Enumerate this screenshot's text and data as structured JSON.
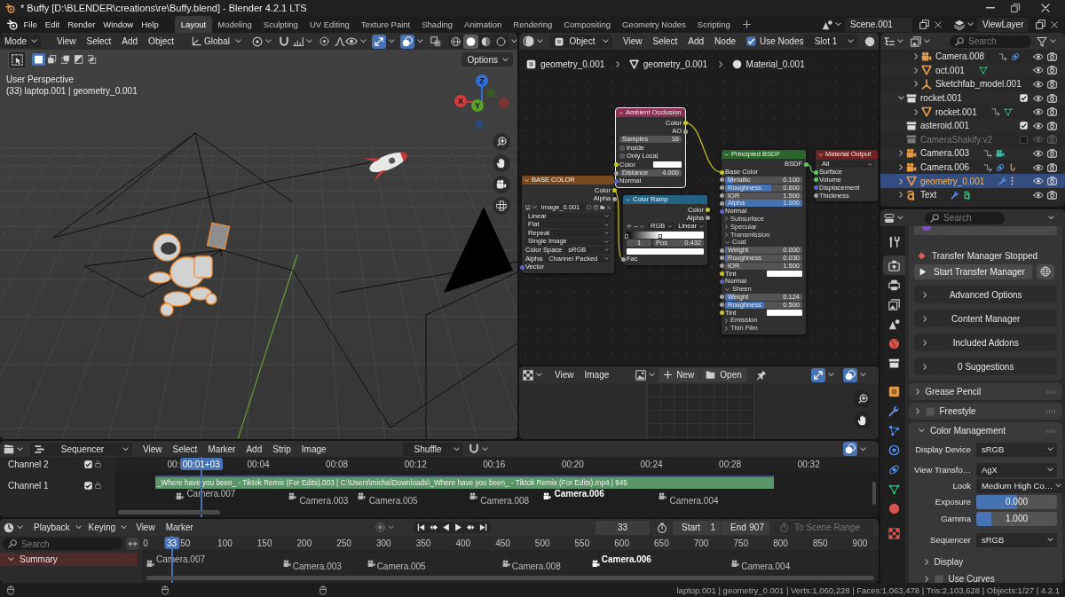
{
  "window": {
    "title": "* Buffy [D:\\BLENDER\\creations\\re\\Buffy.blend] - Blender 4.2.1 LTS"
  },
  "top_bar": {
    "menus": [
      "File",
      "Edit",
      "Render",
      "Window",
      "Help"
    ],
    "workspaces": [
      {
        "label": "Layout",
        "selected": true
      },
      {
        "label": "Modeling",
        "selected": false
      },
      {
        "label": "Sculpting",
        "selected": false
      },
      {
        "label": "UV Editing",
        "selected": false
      },
      {
        "label": "Texture Paint",
        "selected": false
      },
      {
        "label": "Shading",
        "selected": false
      },
      {
        "label": "Animation",
        "selected": false
      },
      {
        "label": "Rendering",
        "selected": false
      },
      {
        "label": "Compositing",
        "selected": false
      },
      {
        "label": "Geometry Nodes",
        "selected": false
      },
      {
        "label": "Scripting",
        "selected": false
      }
    ],
    "scene": "Scene.001",
    "view_layer": "ViewLayer"
  },
  "viewport": {
    "mode": "Mode",
    "menus": [
      "View",
      "Select",
      "Add",
      "Object"
    ],
    "orientation": "Global",
    "toggles": [
      {
        "kind": "gizmos",
        "on": true
      },
      {
        "kind": "overlays",
        "on": true
      },
      {
        "kind": "xray",
        "on": false
      }
    ],
    "shading": [
      {
        "kind": "wireframe",
        "selected": false
      },
      {
        "kind": "solid",
        "selected": true
      },
      {
        "kind": "material",
        "selected": false
      },
      {
        "kind": "rendered",
        "selected": false
      }
    ],
    "select_modes": [
      {
        "kind": "set",
        "selected": true
      },
      {
        "kind": "extend",
        "selected": false
      },
      {
        "kind": "subtract",
        "selected": false
      },
      {
        "kind": "invert",
        "selected": false
      },
      {
        "kind": "intersect",
        "selected": false
      }
    ],
    "options": "Options",
    "info": [
      "User Perspective",
      "(33) laptop.001 | geometry_0.001"
    ],
    "gizmo_axes": [
      "Z",
      "Y",
      "X"
    ]
  },
  "node_editor": {
    "object_type": "Object",
    "menus": [
      "View",
      "Select",
      "Add",
      "Node"
    ],
    "use_nodes": {
      "label": "Use Nodes",
      "checked": true
    },
    "slot": "Slot 1",
    "breadcrumbs": [
      {
        "label": "geometry_0.001",
        "kind": "object"
      },
      {
        "label": "geometry_0.001",
        "kind": "mesh"
      },
      {
        "label": "Material_0.001",
        "kind": "material"
      }
    ],
    "nodes": [
      {
        "title": "BASE COLOR",
        "kind": "texture",
        "selected": false,
        "rows": [
          {
            "kind": "output",
            "label": "Color",
            "color": "#c7c729"
          },
          {
            "kind": "output",
            "label": "Alpha",
            "color": "#a1a1a1"
          },
          {
            "kind": "image",
            "value": "Image_0.001"
          },
          {
            "kind": "dropdown",
            "value": "Linear"
          },
          {
            "kind": "dropdown",
            "value": "Flat"
          },
          {
            "kind": "dropdown",
            "value": "Repeat"
          },
          {
            "kind": "dropdown",
            "value": "Single Image"
          },
          {
            "kind": "dropdown",
            "label": "Color Space",
            "value": "sRGB"
          },
          {
            "kind": "dropdown",
            "label": "Alpha",
            "value": "Channel Packed"
          },
          {
            "kind": "input",
            "label": "Vector",
            "color": "#6363c7"
          }
        ]
      },
      {
        "title": "Ambient Occlusion",
        "kind": "input",
        "selected": true,
        "rows": [
          {
            "kind": "output",
            "label": "Color",
            "color": "#c7c729"
          },
          {
            "kind": "output",
            "label": "AO",
            "color": "#a1a1a1"
          },
          {
            "kind": "number",
            "label": "Samples",
            "value": "16"
          },
          {
            "kind": "checkbox",
            "label": "Inside",
            "checked": false
          },
          {
            "kind": "checkbox",
            "label": "Only Local",
            "checked": false
          },
          {
            "kind": "color",
            "label": "Color",
            "color": "#c7c729"
          },
          {
            "kind": "number",
            "label": "Distance",
            "value": "4.000",
            "color": "#a1a1a1"
          },
          {
            "kind": "input",
            "label": "Normal",
            "color": "#6363c7"
          }
        ]
      },
      {
        "title": "Color Ramp",
        "kind": "converter",
        "selected": false,
        "rows": [
          {
            "kind": "output",
            "label": "Color",
            "color": "#c7c729"
          },
          {
            "kind": "output",
            "label": "Alpha",
            "color": "#a1a1a1"
          },
          {
            "kind": "ramp_controls",
            "mode": "RGB",
            "interpolation": "Linear"
          },
          {
            "kind": "ramp",
            "stops": [
              {
                "level": 0,
                "selected": false
              },
              {
                "level": 0.432,
                "selected": true
              }
            ]
          },
          {
            "kind": "stop",
            "index": "1",
            "label": "Pos",
            "value": "0.432"
          },
          {
            "kind": "swatch"
          },
          {
            "kind": "input",
            "label": "Fac",
            "color": "#a1a1a1"
          }
        ]
      },
      {
        "title": "Principled BSDF",
        "kind": "shader",
        "selected": false,
        "rows": [
          {
            "kind": "output",
            "label": "BSDF",
            "color": "#63c763"
          },
          {
            "kind": "input",
            "label": "Base Color",
            "color": "#c7c729"
          },
          {
            "kind": "slider",
            "label": "Metallic",
            "value": "0.100",
            "level": 0.1,
            "color": "#a1a1a1"
          },
          {
            "kind": "slider",
            "label": "Roughness",
            "value": "0.600",
            "level": 0.6,
            "color": "#a1a1a1"
          },
          {
            "kind": "number",
            "label": "IOR",
            "value": "1.500",
            "color": "#a1a1a1"
          },
          {
            "kind": "slider",
            "label": "Alpha",
            "value": "1.000",
            "level": 1,
            "color": "#a1a1a1"
          },
          {
            "kind": "input",
            "label": "Normal",
            "color": "#6363c7"
          },
          {
            "kind": "panel",
            "label": "Subsurface",
            "expanded": false
          },
          {
            "kind": "panel",
            "label": "Specular",
            "expanded": false
          },
          {
            "kind": "panel",
            "label": "Transmission",
            "expanded": false
          },
          {
            "kind": "panel",
            "label": "Coat",
            "expanded": true
          },
          {
            "kind": "slider",
            "label": "Weight",
            "value": "0.000",
            "level": 0,
            "color": "#a1a1a1"
          },
          {
            "kind": "slider",
            "label": "Roughness",
            "value": "0.030",
            "level": 0.03,
            "color": "#a1a1a1"
          },
          {
            "kind": "number",
            "label": "IOR",
            "value": "1.500",
            "color": "#a1a1a1"
          },
          {
            "kind": "color",
            "label": "Tint",
            "color": "#c7c729"
          },
          {
            "kind": "input",
            "label": "Normal",
            "color": "#6363c7"
          },
          {
            "kind": "panel",
            "label": "Sheen",
            "expanded": true
          },
          {
            "kind": "slider",
            "label": "Weight",
            "value": "0.124",
            "level": 0.124,
            "color": "#a1a1a1"
          },
          {
            "kind": "slider",
            "label": "Roughness",
            "value": "0.500",
            "level": 0.5,
            "color": "#a1a1a1"
          },
          {
            "kind": "color",
            "label": "Tint",
            "color": "#c7c729"
          },
          {
            "kind": "panel",
            "label": "Emission",
            "expanded": false
          },
          {
            "kind": "panel",
            "label": "Thin Film",
            "expanded": false
          }
        ]
      },
      {
        "title": "Material Output",
        "kind": "output",
        "selected": false,
        "rows": [
          {
            "kind": "dropdown",
            "value": "All"
          },
          {
            "kind": "input",
            "label": "Surface",
            "color": "#63c763"
          },
          {
            "kind": "input",
            "label": "Volume",
            "color": "#63c763"
          },
          {
            "kind": "input",
            "label": "Displacement",
            "color": "#6363c7"
          },
          {
            "kind": "input",
            "label": "Thickness",
            "color": "#a1a1a1"
          }
        ]
      }
    ]
  },
  "image_editor": {
    "menus": [
      "View",
      "Image"
    ],
    "new_button": "New",
    "open_button": "Open",
    "toggles": [
      {
        "kind": "gizmos",
        "on": true
      },
      {
        "kind": "overlays",
        "on": true
      }
    ]
  },
  "sequencer": {
    "editor": "Sequencer",
    "menus": [
      "View",
      "Select",
      "Marker",
      "Add",
      "Strip",
      "Image"
    ],
    "overlap_mode": "Shuffle",
    "toggles": [
      {
        "kind": "overlays",
        "on": true
      }
    ],
    "channels": [
      {
        "name": "Channel 2",
        "checked": true
      },
      {
        "name": "Channel 1",
        "checked": true
      }
    ],
    "ruler": [
      "00:",
      "00:04",
      "00:08",
      "00:12",
      "00:16",
      "00:20",
      "00:24",
      "00:28",
      "00:32"
    ],
    "current_time": "00:01+03",
    "strip": "_Where have you been_ - Tiktok Remix (For Edits).003 | C:\\Users\\micha\\Downloads\\_Where have you been_ - Tiktok Remix (For Edits).mp4 | 945",
    "markers": [
      {
        "name": "Camera.007",
        "selected": false
      },
      {
        "name": "Camera.003",
        "selected": false
      },
      {
        "name": "Camera.005",
        "selected": false
      },
      {
        "name": "Camera.008",
        "selected": false
      },
      {
        "name": "Camera.006",
        "selected": true
      },
      {
        "name": "Camera.004",
        "selected": false
      }
    ]
  },
  "timeline": {
    "menus": [
      "Playback",
      "Keying",
      "View",
      "Marker"
    ],
    "current_frame": "33",
    "start": {
      "label": "Start",
      "value": "1"
    },
    "end": {
      "label": "End",
      "value": "907"
    },
    "scene_range": {
      "label": "To Scene Range",
      "disabled": true
    },
    "search": {
      "placeholder": "Search"
    },
    "summary": {
      "label": "Summary",
      "expanded": true
    },
    "ruler": [
      "0",
      "50",
      "100",
      "150",
      "200",
      "250",
      "300",
      "350",
      "400",
      "450",
      "500",
      "550",
      "600",
      "650",
      "700",
      "750",
      "800",
      "850",
      "900"
    ],
    "playhead": "33",
    "markers": [
      {
        "name": "Camera.007",
        "selected": false
      },
      {
        "name": "Camera.003",
        "selected": false
      },
      {
        "name": "Camera.005",
        "selected": false
      },
      {
        "name": "Camera.008",
        "selected": false
      },
      {
        "name": "Camera.006",
        "selected": true
      },
      {
        "name": "Camera.004",
        "selected": false
      }
    ]
  },
  "outliner": {
    "search": {
      "placeholder": "Search"
    },
    "items": [
      {
        "children": [
          {
            "name": "Camera.008",
            "kind": "camera",
            "expanded": false,
            "selected": false,
            "disabled": false,
            "extras": [
              {
                "kind": "constraint"
              },
              {
                "kind": "orbit"
              }
            ]
          },
          {
            "name": "oct.001",
            "kind": "mesh",
            "expanded": false,
            "selected": false,
            "disabled": false,
            "extras": [
              {
                "kind": "mesh_data"
              }
            ]
          },
          {
            "name": "Sketchfab_model.001",
            "kind": "empty",
            "expanded": false,
            "selected": false,
            "disabled": false
          }
        ]
      },
      {
        "name": "rocket.001",
        "kind": "collection",
        "expanded": true,
        "checked": true,
        "selected": false,
        "disabled": false,
        "children": [
          {
            "name": "rocket.001",
            "kind": "mesh",
            "expanded": false,
            "selected": false,
            "disabled": false,
            "extras": [
              {
                "kind": "constraint"
              },
              {
                "kind": "mesh_data"
              }
            ]
          }
        ]
      },
      {
        "name": "asteroid.001",
        "kind": "collection",
        "checked": true,
        "selected": false,
        "disabled": false
      },
      {
        "name": "CameraShakify.v2",
        "kind": "collection",
        "checked": false,
        "selected": false,
        "disabled": true
      },
      {
        "name": "Camera.003",
        "kind": "camera",
        "expanded": false,
        "selected": false,
        "disabled": false,
        "extras": [
          {
            "kind": "constraint"
          },
          {
            "kind": "camera_data"
          }
        ]
      },
      {
        "name": "Camera.006",
        "kind": "camera",
        "expanded": false,
        "selected": false,
        "disabled": false,
        "extras": [
          {
            "kind": "constraint"
          },
          {
            "kind": "orbit"
          },
          {
            "kind": "hook"
          }
        ]
      },
      {
        "name": "geometry_0.001",
        "kind": "mesh",
        "expanded": false,
        "selected": true,
        "disabled": false,
        "extras": [
          {
            "kind": "modifier"
          },
          {
            "kind": "more"
          }
        ]
      },
      {
        "name": "Text",
        "kind": "text",
        "expanded": false,
        "selected": false,
        "disabled": false,
        "extras": [
          {
            "kind": "modifier"
          },
          {
            "kind": "text_data"
          }
        ]
      }
    ]
  },
  "properties": {
    "search": {
      "placeholder": "Search"
    },
    "tabs": [
      {
        "kind": "tool",
        "selected": false
      },
      {
        "kind": "render",
        "selected": true
      },
      {
        "kind": "output",
        "selected": false
      },
      {
        "kind": "view_layer",
        "selected": false
      },
      {
        "kind": "scene",
        "selected": false
      },
      {
        "kind": "world",
        "selected": false
      },
      {
        "kind": "collection",
        "selected": false
      },
      {
        "kind": "object",
        "selected": false
      },
      {
        "kind": "modifiers",
        "selected": false
      },
      {
        "kind": "particles",
        "selected": false
      },
      {
        "kind": "physics",
        "selected": false
      },
      {
        "kind": "constraints",
        "selected": false
      },
      {
        "kind": "data",
        "selected": false
      },
      {
        "kind": "material",
        "selected": false
      },
      {
        "kind": "texture",
        "selected": false
      }
    ],
    "addon": {
      "status": "Transfer Manager Stopped",
      "start_button": "Start Transfer Manager",
      "subpanels": [
        {
          "label": "Advanced Options",
          "expanded": false
        },
        {
          "label": "Content Manager",
          "expanded": false
        },
        {
          "label": "Included Addons",
          "expanded": false
        },
        {
          "label": "0 Suggestions",
          "expanded": false
        }
      ]
    },
    "panels": [
      {
        "label": "Grease Pencil",
        "expanded": false
      },
      {
        "label": "Freestyle",
        "expanded": false,
        "checked": false
      },
      {
        "label": "Color Management",
        "expanded": true,
        "fields": [
          {
            "kind": "dropdown",
            "label": "Display Device",
            "value": "sRGB"
          },
          {
            "kind": "dropdown",
            "label": "View Transfo…",
            "value": "AgX"
          },
          {
            "kind": "dropdown",
            "label": "Look",
            "value": "Medium High Co…"
          },
          {
            "kind": "slider",
            "label": "Exposure",
            "value": "0.000",
            "level": 0.5
          },
          {
            "kind": "slider",
            "label": "Gamma",
            "value": "1.000",
            "level": 0.19
          },
          {
            "kind": "dropdown",
            "label": "Sequencer",
            "value": "sRGB"
          }
        ],
        "subpanels": [
          {
            "label": "Display",
            "expanded": false
          },
          {
            "label": "Use Curves",
            "expanded": false,
            "checked": false
          }
        ]
      }
    ]
  },
  "status_bar": {
    "text": "laptop.001 | geometry_0.001 | Verts:1,060,228 | Faces:1,063,478 | Tris:2,103,628 | Objects:1/27 | 4.2.1"
  }
}
